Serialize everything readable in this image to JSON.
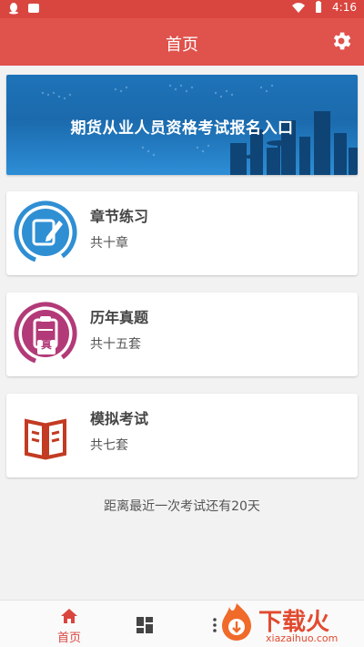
{
  "status_bar": {
    "time": "4:16",
    "icons": [
      "qq-icon",
      "notification-icon",
      "wifi-icon",
      "battery-icon"
    ]
  },
  "app_bar": {
    "title": "首页",
    "settings_icon": "gear-icon"
  },
  "banner": {
    "text": "期货从业人员资格考试报名入口"
  },
  "cards": [
    {
      "title": "章节练习",
      "subtitle": "共十章",
      "icon": "edit-document-icon",
      "color": "#2f8fd3"
    },
    {
      "title": "历年真题",
      "subtitle": "共十五套",
      "icon": "clipboard-icon",
      "badge": "真",
      "color": "#b33a78"
    },
    {
      "title": "模拟考试",
      "subtitle": "共七套",
      "icon": "open-book-icon",
      "color": "#c23b22"
    }
  ],
  "countdown_text": "距离最近一次考试还有20天",
  "bottom_nav": {
    "home_label": "首页"
  },
  "watermark": {
    "text": "下载火",
    "url": "xiazaihuo.com"
  },
  "colors": {
    "primary": "#e0524c",
    "status_bar": "#d9463f"
  }
}
